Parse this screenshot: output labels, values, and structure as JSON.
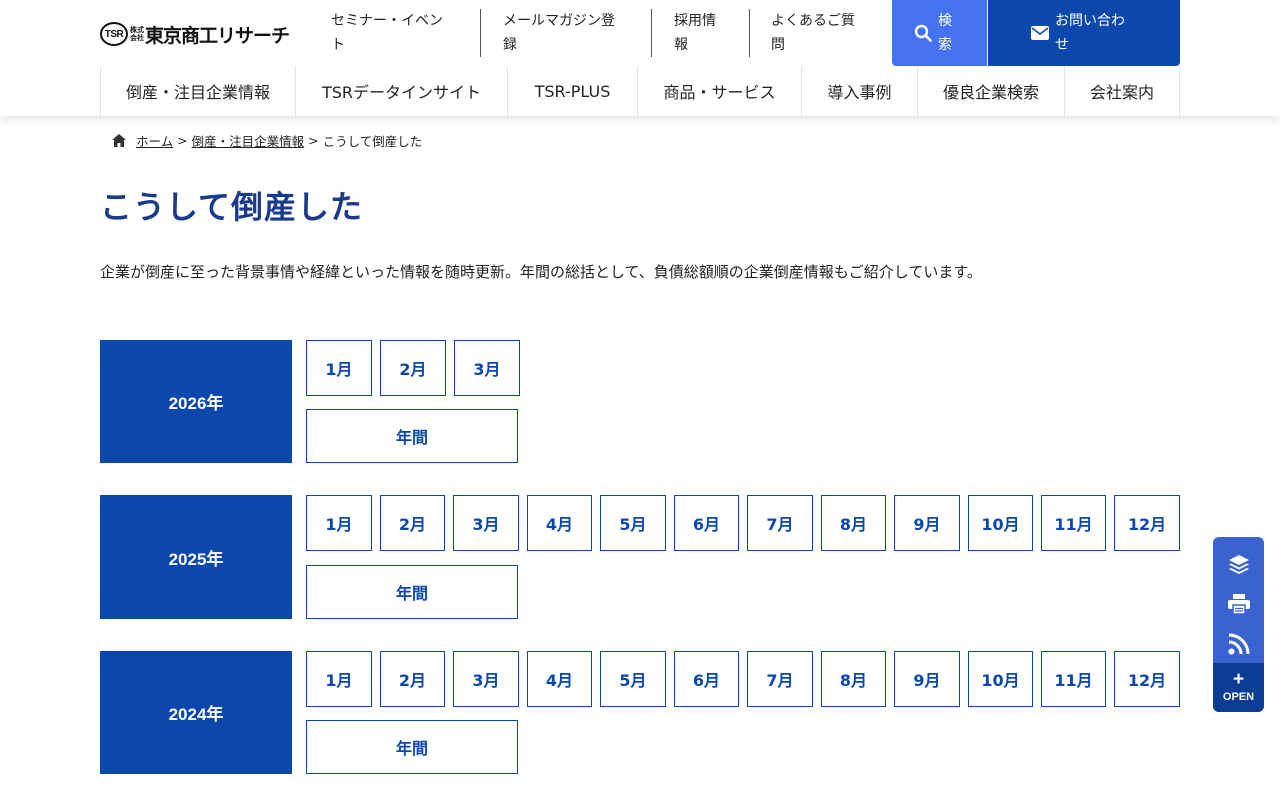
{
  "header": {
    "logo_mark": "TSR",
    "logo_small_1": "株式",
    "logo_small_2": "会社",
    "logo_text": "東京商工リサーチ",
    "util_links": [
      {
        "line1": "セミナー・イベン",
        "line2": "ト"
      },
      {
        "line1": "メールマガジン登",
        "line2": "録"
      },
      {
        "line1": "採用情",
        "line2": "報"
      },
      {
        "line1": "よくあるご質",
        "line2": "問"
      }
    ],
    "search": {
      "line1": "検",
      "line2": "索",
      "icon": "search-icon"
    },
    "contact": {
      "line1": "お問い合わ",
      "line2": "せ",
      "icon": "envelope-icon"
    },
    "accent_color": "#0b47ad",
    "search_color": "#4472f0"
  },
  "nav": [
    {
      "label": "倒産・注目企業情報"
    },
    {
      "label": "TSRデータインサイト"
    },
    {
      "label": "TSR-PLUS"
    },
    {
      "label": "商品・サービス"
    },
    {
      "label": "導入事例"
    },
    {
      "label": "優良企業検索"
    },
    {
      "label": "会社案内"
    }
  ],
  "breadcrumb": {
    "home_icon": "home-icon",
    "home": "ホーム",
    "sep1": ">",
    "parent": "倒産・注目企業情報",
    "sep2": ">",
    "current": "こうして倒産した"
  },
  "page": {
    "title": "こうして倒産した",
    "lead": "企業が倒産に至った背景事情や経緯といった情報を随時更新。年間の総括として、負債総額順の企業倒産情報もご紹介しています。"
  },
  "archive": [
    {
      "year": "2026年",
      "months": [
        "1月",
        "2月",
        "3月"
      ],
      "annual": "年間"
    },
    {
      "year": "2025年",
      "months": [
        "1月",
        "2月",
        "3月",
        "4月",
        "5月",
        "6月",
        "7月",
        "8月",
        "9月",
        "10月",
        "11月",
        "12月"
      ],
      "annual": "年間"
    },
    {
      "year": "2024年",
      "months": [
        "1月",
        "2月",
        "3月",
        "4月",
        "5月",
        "6月",
        "7月",
        "8月",
        "9月",
        "10月",
        "11月",
        "12月"
      ],
      "annual": "年間"
    }
  ],
  "side_panel": {
    "icons": [
      "layers-icon",
      "printer-icon",
      "rss-icon"
    ],
    "open_plus": "+",
    "open_label": "OPEN"
  }
}
